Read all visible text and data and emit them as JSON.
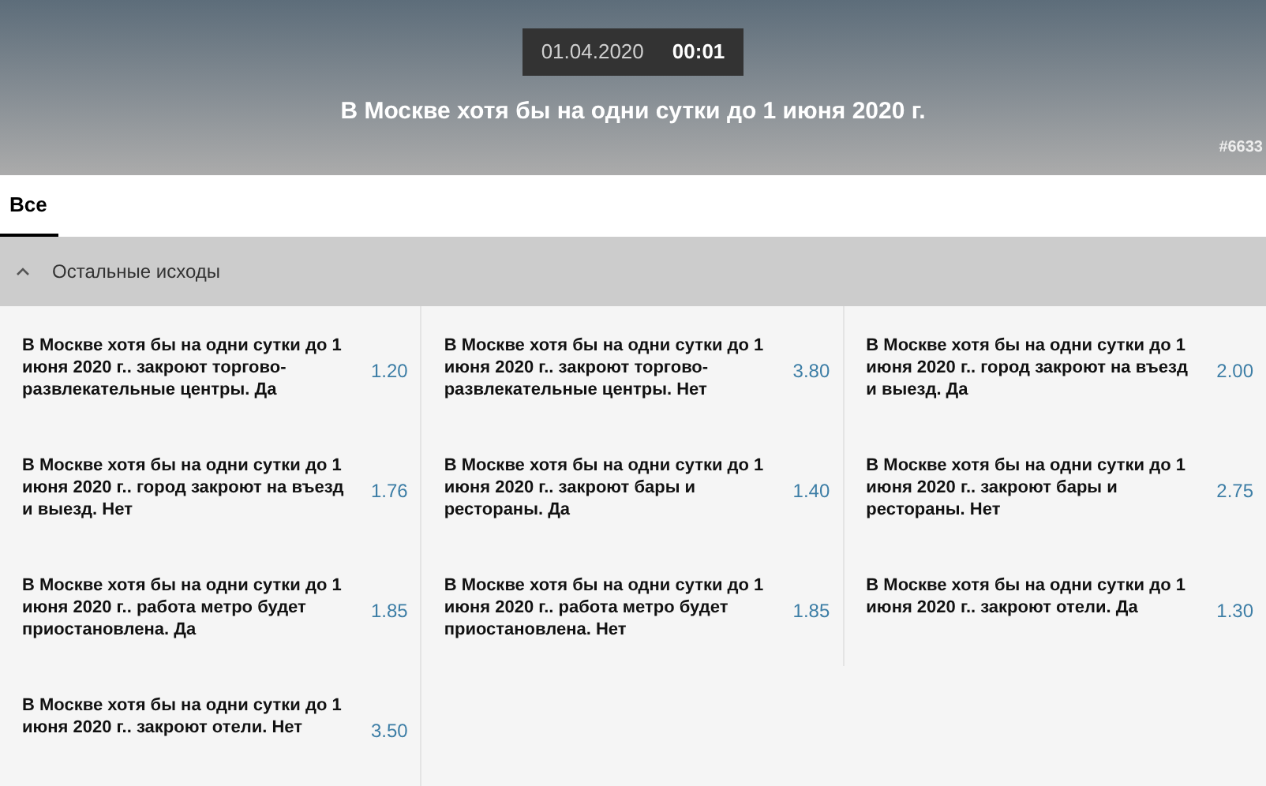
{
  "header": {
    "date": "01.04.2020",
    "time": "00:01",
    "title": "В Москве хотя бы на одни сутки до 1 июня 2020 г.",
    "event_id": "#6633"
  },
  "tabs": [
    {
      "label": "Все",
      "selected": true
    }
  ],
  "section": {
    "title": "Остальные исходы",
    "expanded": true,
    "outcomes": [
      {
        "label": "В Москве хотя бы на одни сутки до 1 июня 2020 г.. закроют торгово-развлекательные центры. Да",
        "odds": "1.20"
      },
      {
        "label": "В Москве хотя бы на одни сутки до 1 июня 2020 г.. закроют торгово-развлекательные центры. Нет",
        "odds": "3.80"
      },
      {
        "label": "В Москве хотя бы на одни сутки до 1 июня 2020 г.. город закроют на въезд и выезд. Да",
        "odds": "2.00"
      },
      {
        "label": "В Москве хотя бы на одни сутки до 1 июня 2020 г.. город закроют на въезд и выезд. Нет",
        "odds": "1.76"
      },
      {
        "label": "В Москве хотя бы на одни сутки до 1 июня 2020 г.. закроют бары и рестораны. Да",
        "odds": "1.40"
      },
      {
        "label": "В Москве хотя бы на одни сутки до 1 июня 2020 г.. закроют бары и рестораны. Нет",
        "odds": "2.75"
      },
      {
        "label": "В Москве хотя бы на одни сутки до 1 июня 2020 г.. работа метро будет приостановлена. Да",
        "odds": "1.85"
      },
      {
        "label": "В Москве хотя бы на одни сутки до 1 июня 2020 г.. работа метро будет приостановлена. Нет",
        "odds": "1.85"
      },
      {
        "label": "В Москве хотя бы на одни сутки до 1 июня 2020 г.. закроют отели. Да",
        "odds": "1.30"
      },
      {
        "label": "В Москве хотя бы на одни сутки до 1 июня 2020 г.. закроют отели. Нет",
        "odds": "3.50"
      }
    ]
  }
}
